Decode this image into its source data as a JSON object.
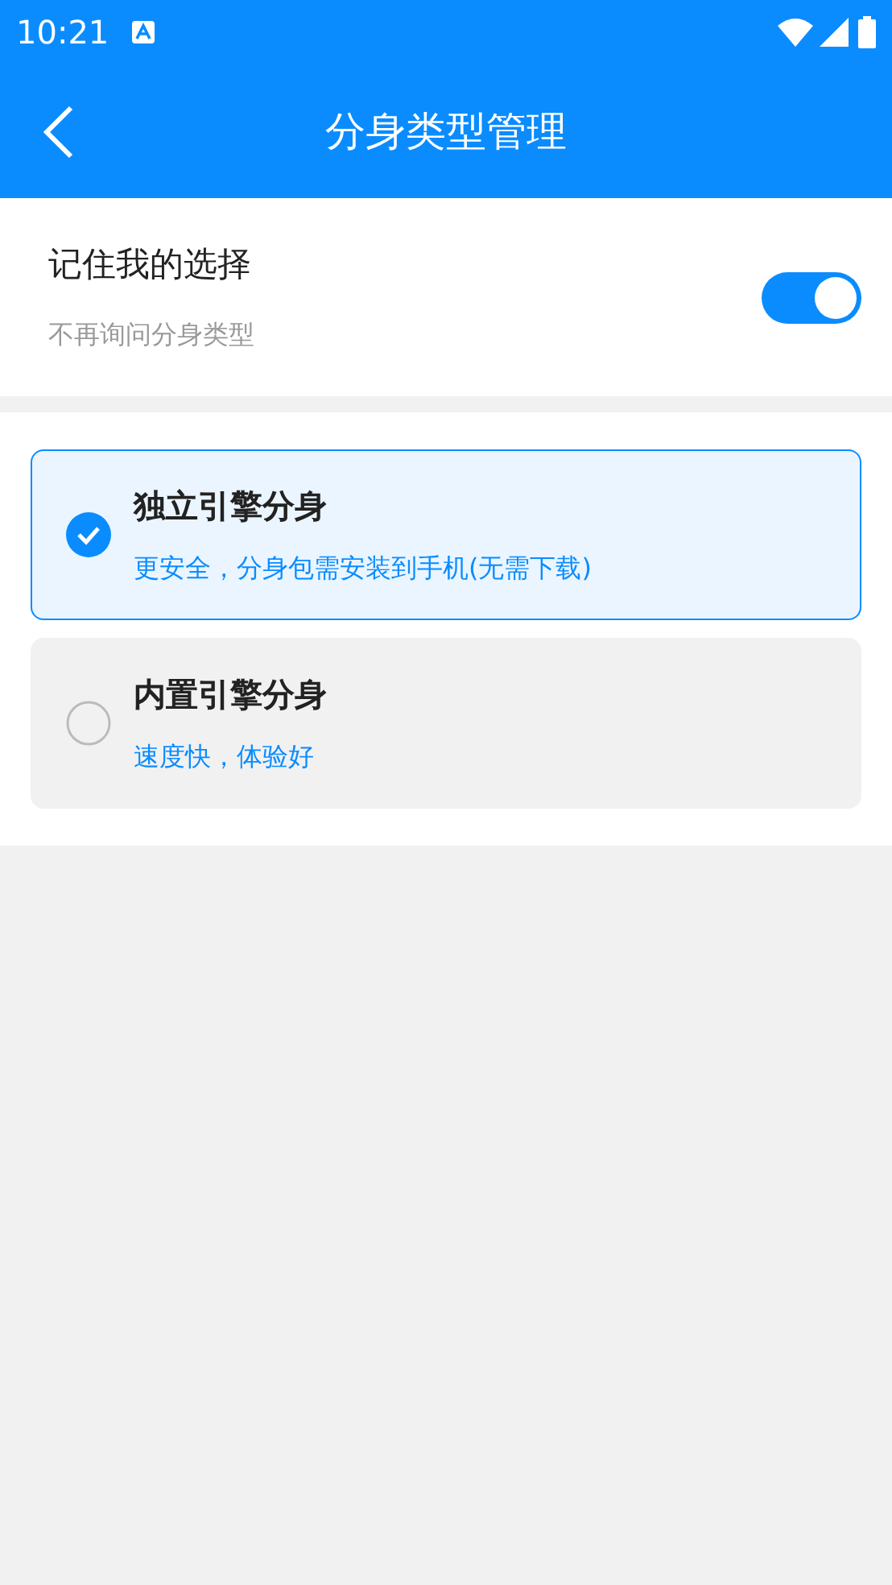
{
  "status_bar": {
    "time": "10:21"
  },
  "header": {
    "title": "分身类型管理"
  },
  "remember": {
    "title": "记住我的选择",
    "subtitle": "不再询问分身类型",
    "on": true
  },
  "options": [
    {
      "title": "独立引擎分身",
      "subtitle": "更安全，分身包需安装到手机(无需下载)",
      "selected": true
    },
    {
      "title": "内置引擎分身",
      "subtitle": "速度快，体验好",
      "selected": false
    }
  ]
}
